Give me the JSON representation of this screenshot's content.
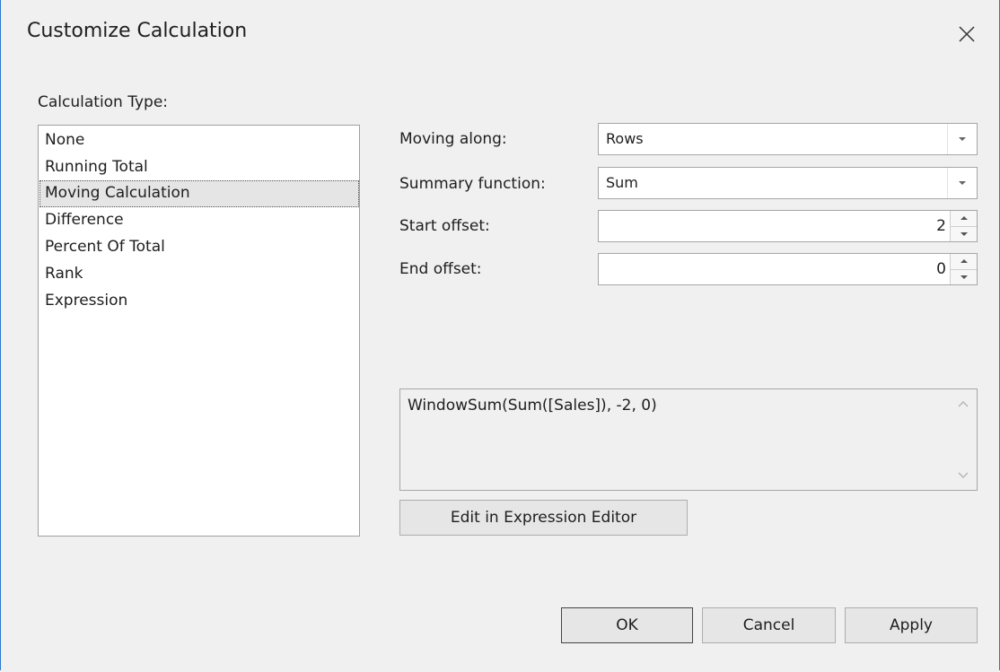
{
  "window": {
    "title": "Customize Calculation",
    "close_icon": "close-icon"
  },
  "calculation_type": {
    "label": "Calculation Type:",
    "items": [
      "None",
      "Running Total",
      "Moving Calculation",
      "Difference",
      "Percent Of Total",
      "Rank",
      "Expression"
    ],
    "selected": "Moving Calculation"
  },
  "fields": {
    "moving_along": {
      "label": "Moving along:",
      "value": "Rows"
    },
    "summary_function": {
      "label": "Summary function:",
      "value": "Sum"
    },
    "start_offset": {
      "label": "Start offset:",
      "value": "2"
    },
    "end_offset": {
      "label": "End offset:",
      "value": "0"
    }
  },
  "expression": {
    "text": "WindowSum(Sum([Sales]), -2, 0)"
  },
  "buttons": {
    "edit_expression": "Edit in Expression Editor",
    "ok": "OK",
    "cancel": "Cancel",
    "apply": "Apply"
  },
  "colors": {
    "window_border": "#2b79d0",
    "background": "#f0f0f0",
    "selection": "#e5e5e5"
  }
}
